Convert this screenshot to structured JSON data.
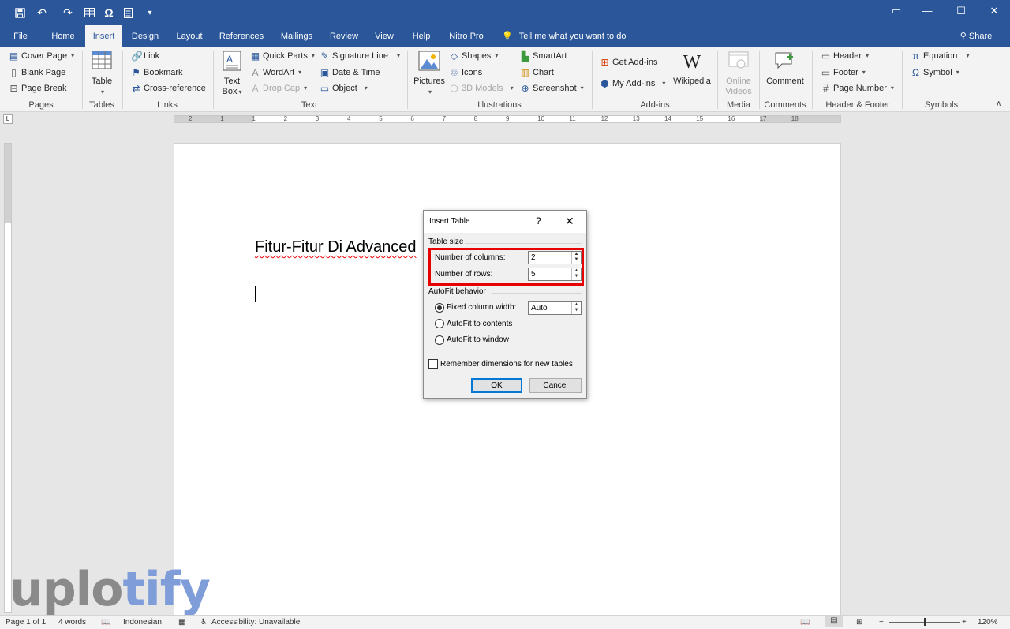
{
  "quick_access": {
    "save_icon": "save-icon",
    "undo_icon": "undo-icon",
    "redo_icon": "redo-icon",
    "table_icon": "table-icon",
    "omega_icon": "omega-icon",
    "doc_icon": "document-icon",
    "customize_icon": "customize-icon",
    "omega_glyph": "Ω"
  },
  "tabs": [
    "File",
    "Home",
    "Insert",
    "Design",
    "Layout",
    "References",
    "Mailings",
    "Review",
    "View",
    "Help",
    "Nitro Pro"
  ],
  "active_tab": "Insert",
  "tell_me": "Tell me what you want to do",
  "share": "Share",
  "ribbon": {
    "pages": {
      "cover_page": "Cover Page",
      "blank_page": "Blank Page",
      "page_break": "Page Break",
      "group": "Pages"
    },
    "tables": {
      "table": "Table",
      "group": "Tables"
    },
    "links": {
      "link": "Link",
      "bookmark": "Bookmark",
      "cross_reference": "Cross-reference",
      "group": "Links"
    },
    "text": {
      "text_box_1": "Text",
      "text_box_2": "Box",
      "quick_parts": "Quick Parts",
      "wordart": "WordArt",
      "drop_cap": "Drop Cap",
      "signature_line": "Signature Line",
      "date_time": "Date & Time",
      "object": "Object",
      "group": "Text"
    },
    "illustrations": {
      "pictures": "Pictures",
      "shapes": "Shapes",
      "icons": "Icons",
      "models_3d": "3D Models",
      "smartart": "SmartArt",
      "chart": "Chart",
      "screenshot": "Screenshot",
      "group": "Illustrations"
    },
    "addins": {
      "get_addins": "Get Add-ins",
      "my_addins": "My Add-ins",
      "wikipedia": "Wikipedia",
      "wiki_glyph": "W",
      "group": "Add-ins"
    },
    "media": {
      "online_1": "Online",
      "online_2": "Videos",
      "group": "Media"
    },
    "comments": {
      "comment": "Comment",
      "group": "Comments"
    },
    "header_footer": {
      "header": "Header",
      "footer": "Footer",
      "page_number": "Page Number",
      "group": "Header & Footer"
    },
    "symbols": {
      "equation": "Equation",
      "symbol": "Symbol",
      "group": "Symbols",
      "pi_glyph": "π",
      "omega_glyph": "Ω"
    }
  },
  "ruler": {
    "labels": [
      "2",
      "1",
      "1",
      "2",
      "3",
      "4",
      "5",
      "6",
      "7",
      "8",
      "9",
      "10",
      "11",
      "12",
      "13",
      "14",
      "15",
      "16",
      "17",
      "18"
    ],
    "tab_selector": "L"
  },
  "document": {
    "heading": "Fitur-Fitur Di Advanced"
  },
  "dialog": {
    "title": "Insert Table",
    "help": "?",
    "close": "✕",
    "table_size": "Table size",
    "columns_label": "Number of columns:",
    "columns_value": "2",
    "rows_label": "Number of rows:",
    "rows_value": "5",
    "autofit": "AutoFit behavior",
    "fixed_width": "Fixed column width:",
    "fixed_value": "Auto",
    "fit_contents": "AutoFit to contents",
    "fit_window": "AutoFit to window",
    "remember": "Remember dimensions for new tables",
    "ok": "OK",
    "cancel": "Cancel",
    "selected_option": "Fixed column width"
  },
  "statusbar": {
    "page": "Page 1 of 1",
    "words": "4 words",
    "language": "Indonesian",
    "accessibility": "Accessibility: Unavailable",
    "zoom": "120%",
    "zoom_minus": "−",
    "zoom_plus": "+"
  },
  "watermark": {
    "part1": "uplo",
    "part2": "tify"
  }
}
